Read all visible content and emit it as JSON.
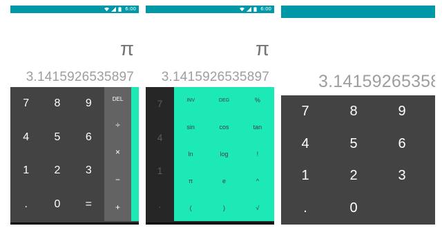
{
  "status_bar": {
    "time": "6:00"
  },
  "display": {
    "formula": "π",
    "result": "3.1415926535897",
    "result_cropped": "3.14159265358"
  },
  "number_keys": [
    "7",
    "8",
    "9",
    "4",
    "5",
    "6",
    "1",
    "2",
    "3",
    ".",
    "0",
    "="
  ],
  "operator_keys": [
    "DEL",
    "÷",
    "×",
    "−",
    "+"
  ],
  "advanced_keys": [
    "INV",
    "DEG",
    "%",
    "sin",
    "cos",
    "tan",
    "ln",
    "log",
    "!",
    "π",
    "e",
    "^",
    "(",
    ")",
    "√"
  ],
  "colors": {
    "status_bar": "#0097a7",
    "accent": "#1de9b6",
    "pad": "#434343",
    "operator_column": "#636363"
  }
}
